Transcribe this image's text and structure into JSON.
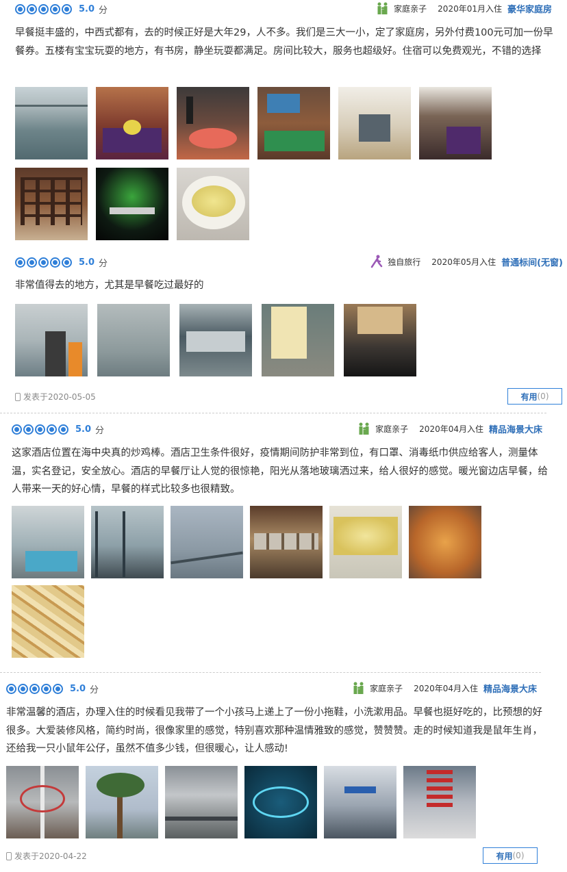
{
  "reviews": [
    {
      "score": "5.0",
      "unit": "分",
      "traveler": "家庭亲子",
      "traveler_icon": "family-icon",
      "date": "2020年01月入住",
      "room": "豪华家庭房",
      "text": "早餐挺丰盛的，中西式都有，去的时候正好是大年29，人不多。我们是三大一小，定了家庭房，另外付费100元可加一份早餐券。五楼有宝宝玩耍的地方，有书房，静坐玩耍都满足。房间比较大，服务也超级好。住宿可以免费观光，不错的选择"
    },
    {
      "score": "5.0",
      "unit": "分",
      "traveler": "独自旅行",
      "traveler_icon": "solo-walker-icon",
      "date": "2020年05月入住",
      "room": "普通标间(无窗)",
      "text": "非常值得去的地方，尤其是早餐吃过最好的",
      "posted": "发表于2020-05-05",
      "useful_label": "有用",
      "useful_count": "(0)"
    },
    {
      "score": "5.0",
      "unit": "分",
      "traveler": "家庭亲子",
      "traveler_icon": "family-icon",
      "date": "2020年04月入住",
      "room": "精品海景大床",
      "text": "这家酒店位置在海中央真的炒鸡棒。酒店卫生条件很好，疫情期间防护非常到位，有口罩、消毒纸巾供应给客人，测量体温，实名登记，安全放心。酒店的早餐厅让人觉的很惊艳，阳光从落地玻璃洒过来，给人很好的感觉。暖光窗边店早餐，给人带来一天的好心情，早餐的样式比较多也很精致。"
    },
    {
      "score": "5.0",
      "unit": "分",
      "traveler": "家庭亲子",
      "traveler_icon": "family-icon",
      "date": "2020年04月入住",
      "room": "精品海景大床",
      "text": "非常温馨的酒店，办理入住的时候看见我带了一个小孩马上递上了一份小拖鞋，小洗漱用品。早餐也挺好吃的，比预想的好很多。大爱装修风格，简约时尚，很像家里的感觉，特别喜欢那种温情雅致的感觉，赞赞赞。走的时候知道我是鼠年生肖，还给我一只小鼠年公仔，虽然不值多少钱，但很暖心，让人感动!",
      "posted": "发表于2020-04-22",
      "useful_label": "有用",
      "useful_count": "(0)"
    }
  ],
  "colors": {
    "accent": "#2f7fd8",
    "room_link": "#2f6fb8",
    "traveler_green": "#6aa84f",
    "traveler_purple": "#9b59b6"
  }
}
